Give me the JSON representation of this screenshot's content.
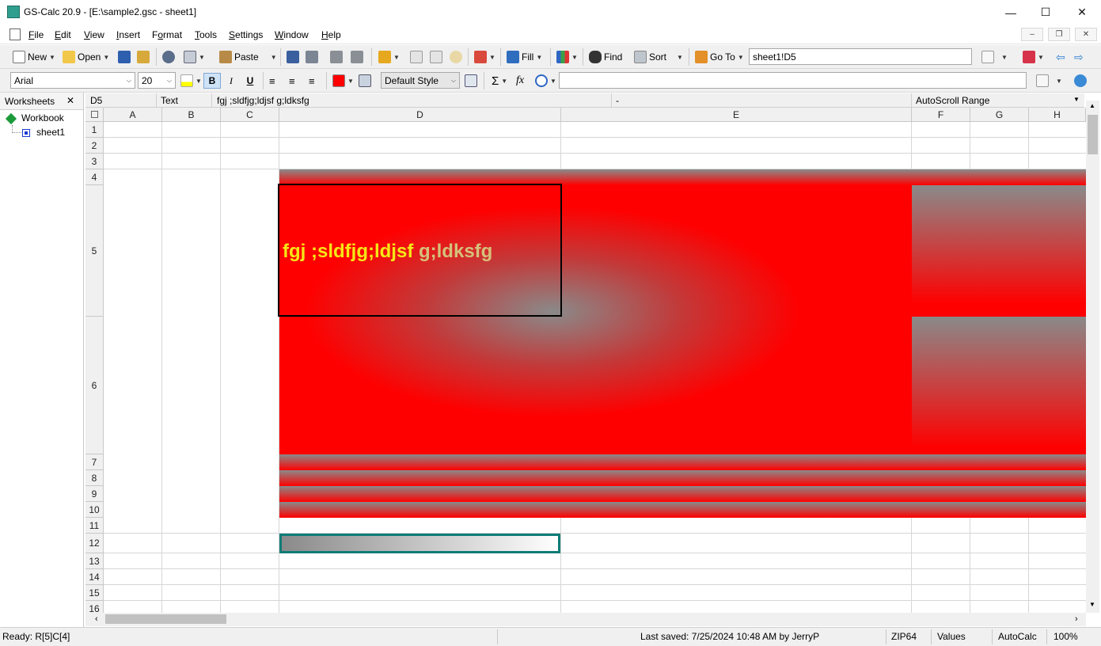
{
  "window": {
    "title": "GS-Calc 20.9 - [E:\\sample2.gsc - sheet1]",
    "minimize": "—",
    "maximize": "☐",
    "close": "✕"
  },
  "menu": {
    "items": [
      "File",
      "Edit",
      "View",
      "Insert",
      "Format",
      "Tools",
      "Settings",
      "Window",
      "Help"
    ],
    "accel": [
      "F",
      "E",
      "V",
      "I",
      "o",
      "T",
      "S",
      "W",
      "H"
    ]
  },
  "toolbar1": {
    "new": "New",
    "open": "Open",
    "paste": "Paste",
    "fill": "Fill",
    "find": "Find",
    "sort": "Sort",
    "goto": "Go To",
    "goto_value": "sheet1!D5"
  },
  "toolbar2": {
    "font": "Arial",
    "size": "20",
    "bold": "B",
    "italic": "I",
    "underline": "U",
    "style": "Default Style",
    "sigma": "Σ",
    "fx": "fx",
    "formula_value": ""
  },
  "sidebar": {
    "title": "Worksheets",
    "close": "✕",
    "workbook": "Workbook",
    "sheet": "sheet1"
  },
  "namebar": {
    "cell": "D5",
    "type": "Text",
    "content": "fgj ;sldfjg;ldjsf g;ldksfg",
    "dash": "-",
    "range": "AutoScroll Range"
  },
  "columns": [
    "A",
    "B",
    "C",
    "D",
    "E",
    "F",
    "G",
    "H"
  ],
  "rows": [
    "1",
    "2",
    "3",
    "4",
    "5",
    "6",
    "7",
    "8",
    "9",
    "10",
    "11",
    "12",
    "13",
    "14",
    "15",
    "16"
  ],
  "cells": {
    "d5_part1": "fgj ;sldfjg;ldjsf ",
    "d5_part2": "g;ldksfg"
  },
  "colors": {
    "fill_red": "#ff0000",
    "gradient_gray": "#8a8a8a",
    "text_yellow": "#f5e616",
    "text_khaki": "#d6c07a",
    "selection_teal": "#0f7c77"
  },
  "status": {
    "ready": "Ready:  R[5]C[4]",
    "saved": "Last saved:  7/25/2024 10:48 AM  by  JerryP",
    "zip": "ZIP64",
    "values": "Values",
    "autocalc": "AutoCalc",
    "zoom": "100%"
  }
}
